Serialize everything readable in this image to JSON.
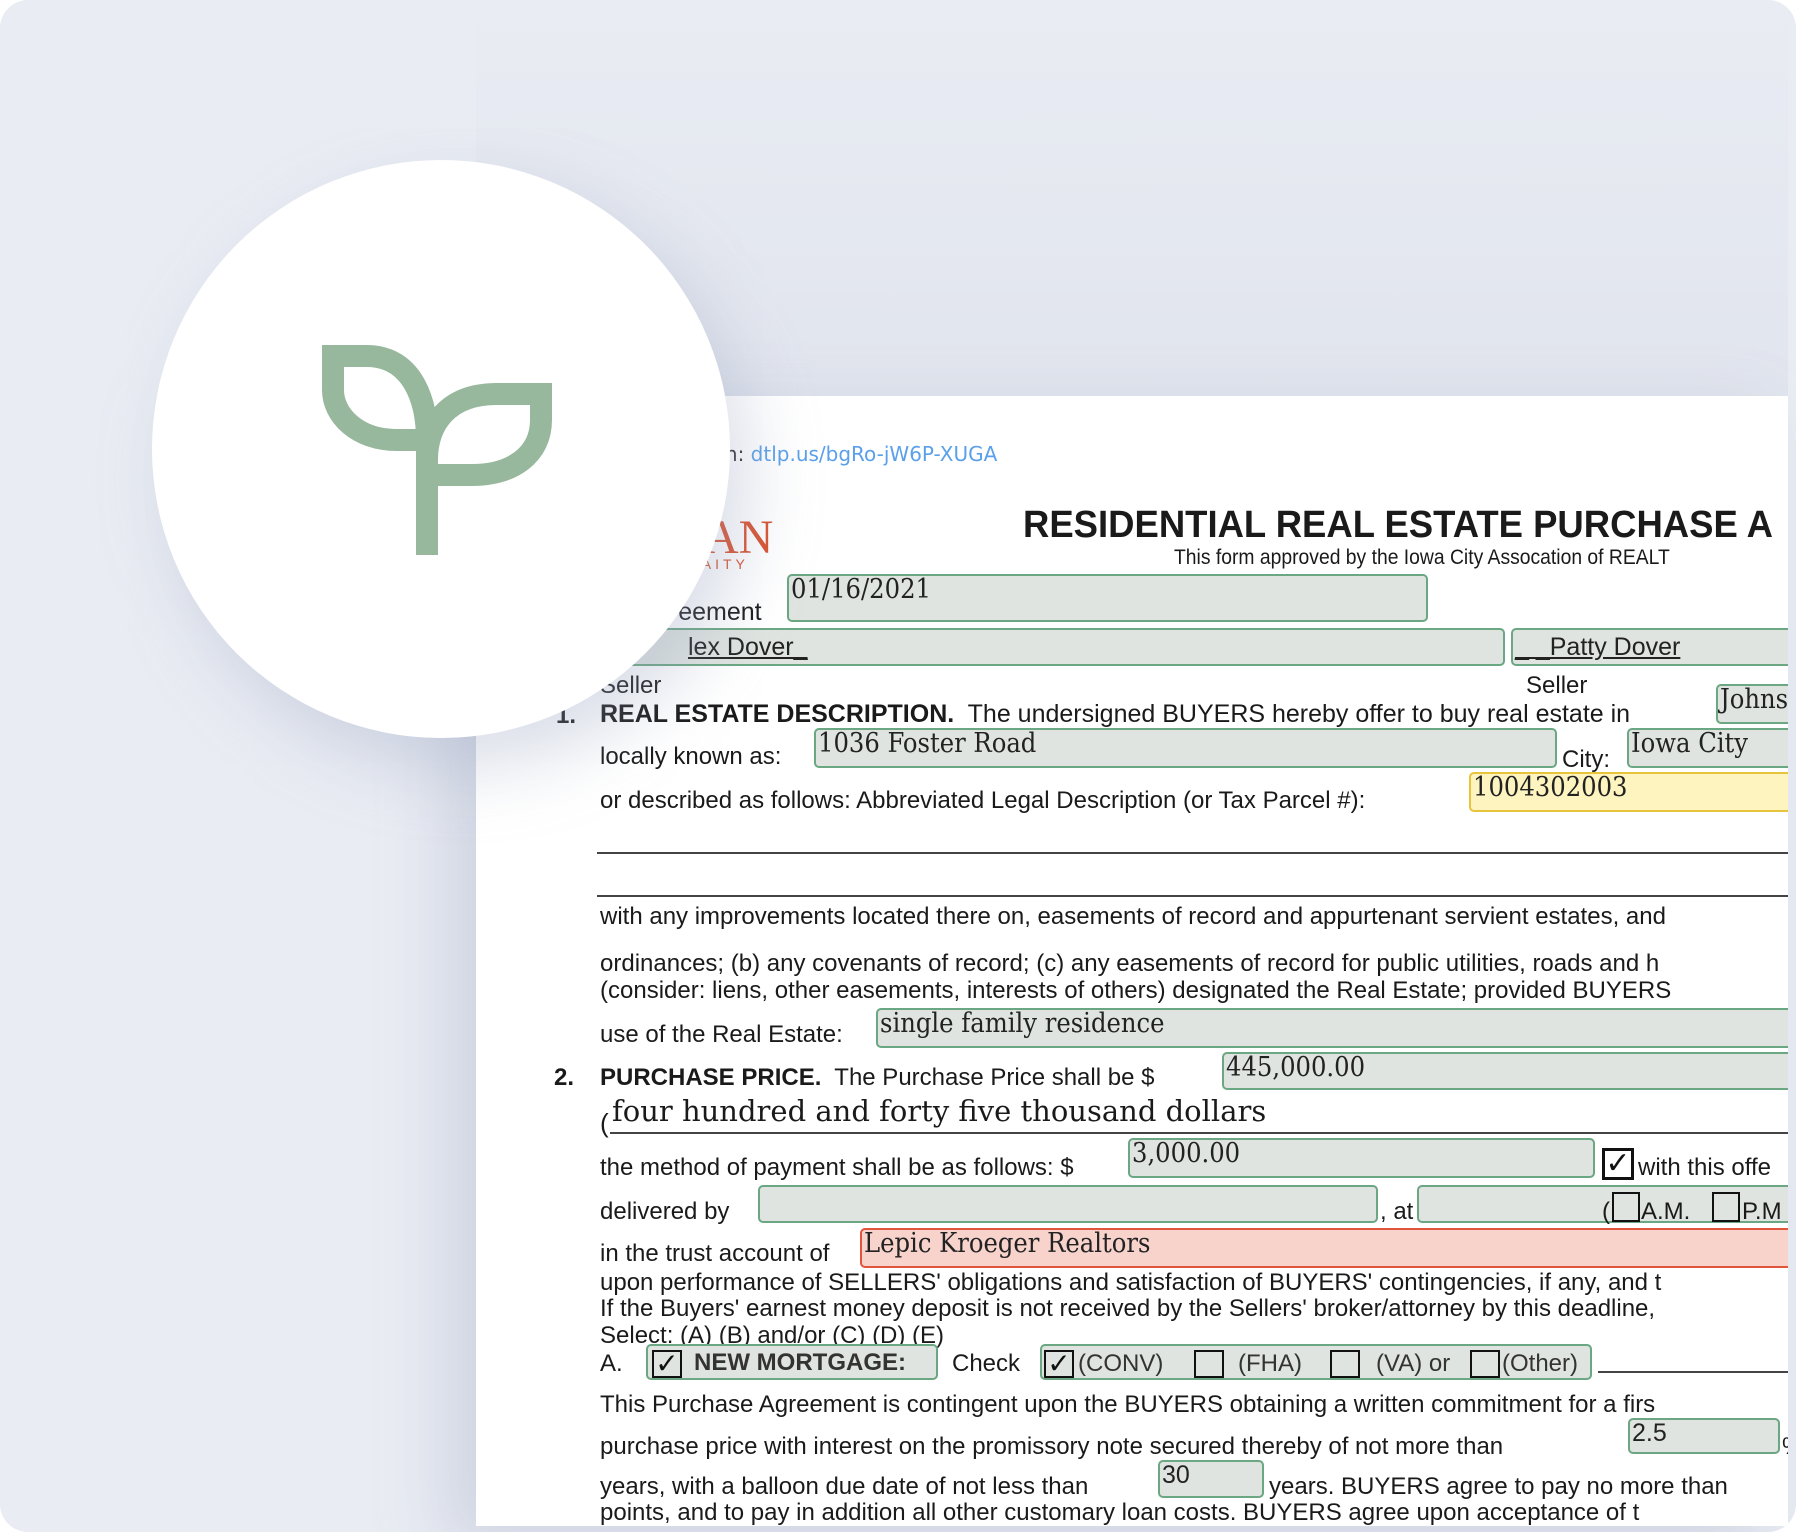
{
  "verification": {
    "label_partial": "cation:",
    "link": "dtlp.us/bgRo-jW6P-XUGA",
    "link_color": "#5aa0ea"
  },
  "logo": {
    "brand_partial": "IAN",
    "tagline_partial": "FAITY",
    "color": "#d9532f"
  },
  "badge": {
    "icon": "sprout-icon",
    "icon_color": "#97b89d"
  },
  "document": {
    "title": "RESIDENTIAL REAL ESTATE PURCHASE A",
    "subtitle": "This form approved by the Iowa City Assocation of REALT",
    "agreement_label_partial": "greement",
    "date_field": "01/16/2021",
    "seller1_partial": "lex Dover_",
    "seller2": "_ _Patty Dover",
    "seller_label": "Seller",
    "section1": {
      "number": "1.",
      "heading": "REAL ESTATE DESCRIPTION.",
      "text": "The undersigned BUYERS hereby offer to buy real estate in",
      "county_field": "Johns",
      "locally_known_label": "locally known as:",
      "address_field": "1036 Foster Road",
      "city_label": "City:",
      "city_field": "Iowa City",
      "described_label": "or described as follows:  Abbreviated Legal Description (or Tax Parcel #):",
      "parcel_field": "1004302003",
      "line_with": "with any improvements located there on, easements of record and appurtenant servient estates, and",
      "line_ordinances": "ordinances; (b) any covenants of record; (c) any easements of record for public utilities, roads and h",
      "line_consider": "(consider: liens, other easements, interests of others) designated the Real Estate; provided BUYERS",
      "use_label": "use of the Real Estate:",
      "use_field": "single family residence"
    },
    "section2": {
      "number": "2.",
      "heading": "PURCHASE PRICE.",
      "text": "The Purchase Price shall be $",
      "price_field": "445,000.00",
      "price_words_paren": "(",
      "price_words": "four hundred and forty five thousand dollars",
      "method_label": "the method of payment shall be as follows: $",
      "earnest_field": "3,000.00",
      "with_offer_checked": true,
      "with_offer_label": "with this offe",
      "delivered_label": "delivered by",
      "delivered_field": "",
      "at_label": ", at",
      "time_field": "",
      "am_paren": "(",
      "am_label": "A.M.",
      "pm_label": "P.M",
      "am_checked": false,
      "pm_checked": false,
      "trust_label": "in the trust account of",
      "trust_field": "Lepic Kroeger Realtors",
      "line_upon": "upon performance of SELLERS' obligations and satisfaction of BUYERS' contingencies, if any, and t",
      "line_if": "If the Buyers' earnest money deposit is not received by the Sellers' broker/attorney by this deadline,",
      "line_select": "Select:  (A) (B) and/or (C) (D) (E)",
      "item_a_letter": "A.",
      "new_mortgage_checked": true,
      "new_mortgage_label": "NEW MORTGAGE:",
      "check_label": "Check",
      "loan_types": [
        {
          "label": "(CONV)",
          "checked": true
        },
        {
          "label": "(FHA)",
          "checked": false
        },
        {
          "label": "(VA) or",
          "checked": false
        },
        {
          "label": "(Other)",
          "checked": false
        }
      ],
      "line_contingent": "This Purchase Agreement is contingent upon the BUYERS obtaining a written commitment for a firs",
      "line_purchase": "purchase price with interest on the promissory note secured thereby of not more than",
      "interest_field": "2.5",
      "interest_suffix": "%",
      "line_years_a": "years, with a balloon due date of not less than",
      "balloon_field": "30",
      "line_years_b": "years.  BUYERS agree to pay no more than",
      "line_points": "points, and to pay in addition all other customary loan costs.  BUYERS agree upon acceptance of t"
    }
  },
  "colors": {
    "background": "#e9ecf3",
    "field_fill": "#dfe4e0",
    "field_border": "#6aa782",
    "highlight_yellow": "#fdf4bf",
    "highlight_red": "#f8d3cc"
  }
}
